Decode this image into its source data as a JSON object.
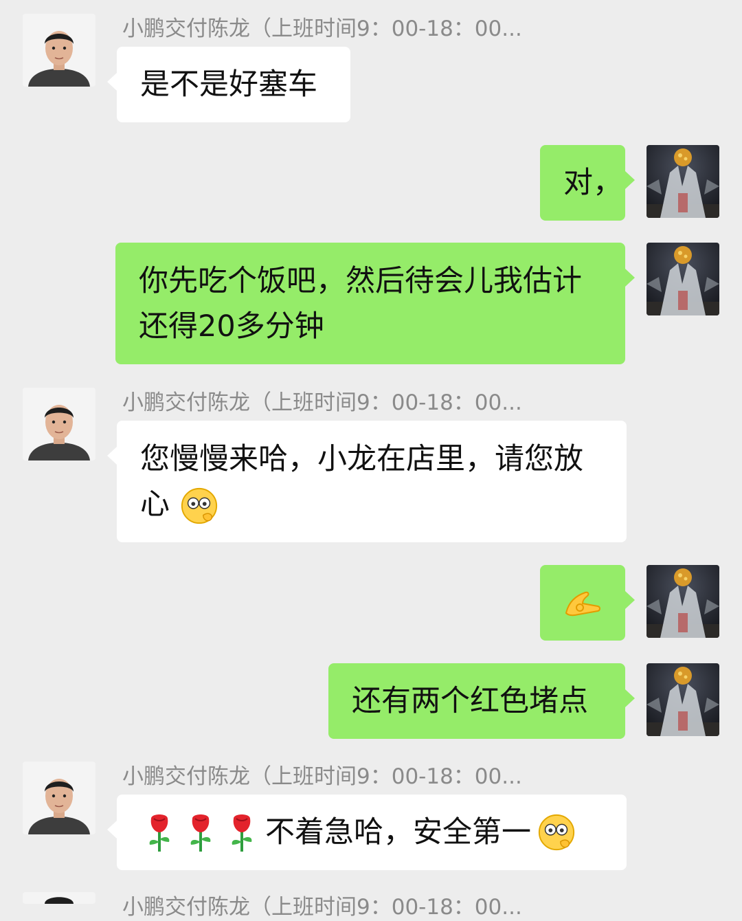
{
  "chat": {
    "contact_name": "小鹏交付陈龙（上班时间9：00-18：00...",
    "messages": [
      {
        "from": "contact",
        "text": "是不是好塞车"
      },
      {
        "from": "me",
        "text": "对，"
      },
      {
        "from": "me",
        "text": "你先吃个饭吧，然后待会儿我估计还得20多分钟"
      },
      {
        "from": "contact",
        "text": "您慢慢来哈，小龙在店里，请您放心",
        "emoji": "face-with-monocle-emoji"
      },
      {
        "from": "me",
        "emoji": "ok-hand-emoji"
      },
      {
        "from": "me",
        "text": "还有两个红色堵点"
      },
      {
        "from": "contact",
        "text": "不着急哈，安全第一",
        "leading_emoji": [
          "rose-emoji",
          "rose-emoji",
          "rose-emoji"
        ],
        "emoji": "face-with-monocle-emoji"
      }
    ]
  },
  "colors": {
    "background": "#ededed",
    "incoming_bubble": "#ffffff",
    "outgoing_bubble": "#95ec69",
    "sender_name": "#8a8a8a"
  }
}
